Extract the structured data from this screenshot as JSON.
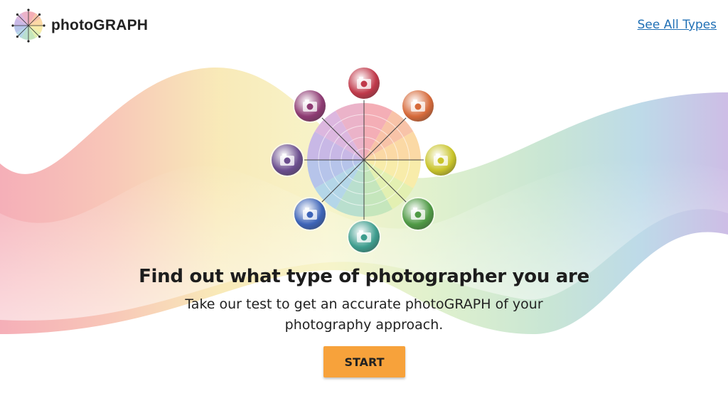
{
  "header": {
    "brand": "photoGRAPH",
    "see_all_label": "See All Types"
  },
  "hero": {
    "headline": "Find out what type of photographer you are",
    "subline": "Take our test to get an accurate photoGRAPH of your photography approach.",
    "start_label": "START"
  },
  "wheel": {
    "segments": [
      {
        "color": "#f4aeb6"
      },
      {
        "color": "#f8c3a8"
      },
      {
        "color": "#fbd9a5"
      },
      {
        "color": "#f8ecaa"
      },
      {
        "color": "#e3f0b2"
      },
      {
        "color": "#c5e6bc"
      },
      {
        "color": "#b9dfce"
      },
      {
        "color": "#b4d6e8"
      },
      {
        "color": "#b6c4ea"
      },
      {
        "color": "#c8b8e6"
      },
      {
        "color": "#dcb7df"
      },
      {
        "color": "#ebb3c9"
      }
    ],
    "thumbnails": [
      {
        "name": "photo-type-red-thumb",
        "color": "#c0394a",
        "icon": "camera-icon"
      },
      {
        "name": "photo-type-orange-thumb",
        "color": "#d66a3a",
        "icon": "camera-icon"
      },
      {
        "name": "photo-type-yellow-thumb",
        "color": "#c9c42a",
        "icon": "camera-icon"
      },
      {
        "name": "photo-type-green-thumb",
        "color": "#4f9a45",
        "icon": "camera-icon"
      },
      {
        "name": "photo-type-teal-thumb",
        "color": "#3e9d8e",
        "icon": "camera-icon"
      },
      {
        "name": "photo-type-blue-thumb",
        "color": "#3d64b8",
        "icon": "camera-icon"
      },
      {
        "name": "photo-type-indigo-thumb",
        "color": "#6b4e8e",
        "icon": "camera-icon"
      },
      {
        "name": "photo-type-purple-thumb",
        "color": "#8e3b73",
        "icon": "camera-icon"
      }
    ]
  }
}
